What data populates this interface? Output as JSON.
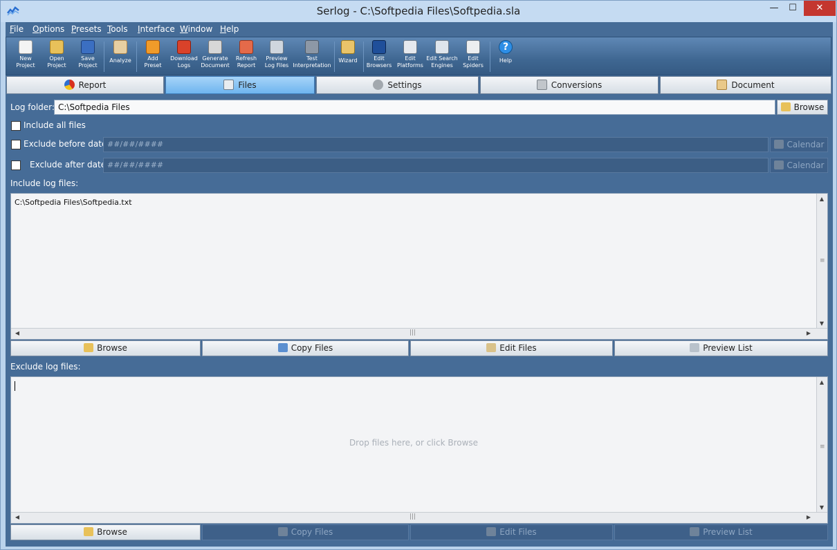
{
  "window": {
    "title": "Serlog - C:\\Softpedia Files\\Softpedia.sla",
    "min": "—",
    "max": "☐",
    "close": "✕"
  },
  "menu": [
    {
      "label": "File",
      "u": "F",
      "rest": "ile"
    },
    {
      "label": "Options",
      "u": "O",
      "rest": "ptions"
    },
    {
      "label": "Presets",
      "u": "P",
      "rest": "resets"
    },
    {
      "label": "Tools",
      "u": "T",
      "rest": "ools"
    },
    {
      "label": "Interface",
      "u": "I",
      "rest": "nterface"
    },
    {
      "label": "Window",
      "u": "W",
      "rest": "indow"
    },
    {
      "label": "Help",
      "u": "H",
      "rest": "elp"
    }
  ],
  "toolbar": {
    "new": {
      "l1": "New",
      "l2": "Project",
      "icon": "new-document-icon"
    },
    "open": {
      "l1": "Open",
      "l2": "Project",
      "icon": "open-folder-icon"
    },
    "save": {
      "l1": "Save",
      "l2": "Project",
      "icon": "save-disk-icon"
    },
    "analyze": {
      "l1": "Analyze",
      "l2": "",
      "icon": "analyze-icon"
    },
    "add_preset": {
      "l1": "Add",
      "l2": "Preset",
      "icon": "add-preset-icon"
    },
    "download": {
      "l1": "Download",
      "l2": "Logs",
      "icon": "download-icon"
    },
    "generate": {
      "l1": "Generate",
      "l2": "Document",
      "icon": "generate-icon"
    },
    "refresh": {
      "l1": "Refresh",
      "l2": "Report",
      "icon": "refresh-icon"
    },
    "preview": {
      "l1": "Preview",
      "l2": "Log Files",
      "icon": "preview-icon"
    },
    "test": {
      "l1": "Test",
      "l2": "Interpretation",
      "icon": "microscope-icon"
    },
    "wizard": {
      "l1": "Wizard",
      "l2": "",
      "icon": "wizard-icon"
    },
    "edit_browsers": {
      "l1": "Edit",
      "l2": "Browsers",
      "icon": "browser-icon"
    },
    "edit_platforms": {
      "l1": "Edit",
      "l2": "Platforms",
      "icon": "platform-icon"
    },
    "edit_search": {
      "l1": "Edit Search",
      "l2": "Engines",
      "icon": "search-engine-icon"
    },
    "edit_spiders": {
      "l1": "Edit",
      "l2": "Spiders",
      "icon": "spider-icon"
    },
    "help": {
      "l1": "Help",
      "l2": "",
      "icon": "help-icon"
    }
  },
  "tabs": {
    "report": "Report",
    "files": "Files",
    "settings": "Settings",
    "conversions": "Conversions",
    "document": "Document"
  },
  "files": {
    "log_folder_label": "Log folder:",
    "log_folder_value": "C:\\Softpedia Files",
    "browse": "Browse",
    "include_all": "Include all files",
    "exclude_before": "Exclude before date",
    "exclude_after": "Exclude after date",
    "date_placeholder": "##/##/####",
    "calendar": "Calendar",
    "include_label": "Include log files:",
    "include_items": [
      "C:\\Softpedia Files\\Softpedia.txt"
    ],
    "exclude_label": "Exclude log files:",
    "drop_hint": "Drop files here, or click Browse",
    "actions": {
      "browse": "Browse",
      "copy": "Copy Files",
      "edit": "Edit Files",
      "preview": "Preview List"
    }
  }
}
